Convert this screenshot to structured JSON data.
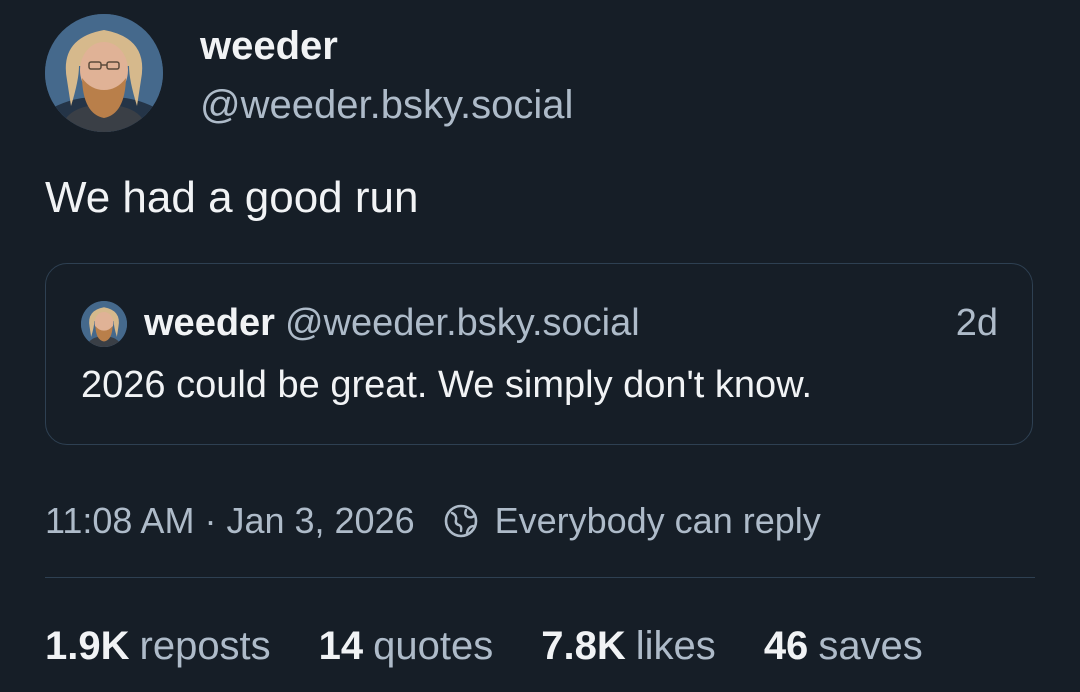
{
  "post": {
    "author": {
      "name": "weeder",
      "handle": "@weeder.bsky.social"
    },
    "text": "We had a good run",
    "quote": {
      "author_name": "weeder",
      "author_handle": "@weeder.bsky.social",
      "time": "2d",
      "text": "2026 could be great. We simply don't know."
    },
    "meta": {
      "time": "11:08 AM",
      "separator": "·",
      "date": "Jan 3, 2026",
      "reply_setting": "Everybody can reply",
      "reply_icon": "globe-icon"
    },
    "stats": {
      "reposts": {
        "count": "1.9K",
        "label": "reposts"
      },
      "quotes": {
        "count": "14",
        "label": "quotes"
      },
      "likes": {
        "count": "7.8K",
        "label": "likes"
      },
      "saves": {
        "count": "46",
        "label": "saves"
      }
    }
  },
  "colors": {
    "background": "#161e27",
    "text_primary": "#f1f3f5",
    "text_secondary": "#aebbc9",
    "border": "#2e4052"
  }
}
